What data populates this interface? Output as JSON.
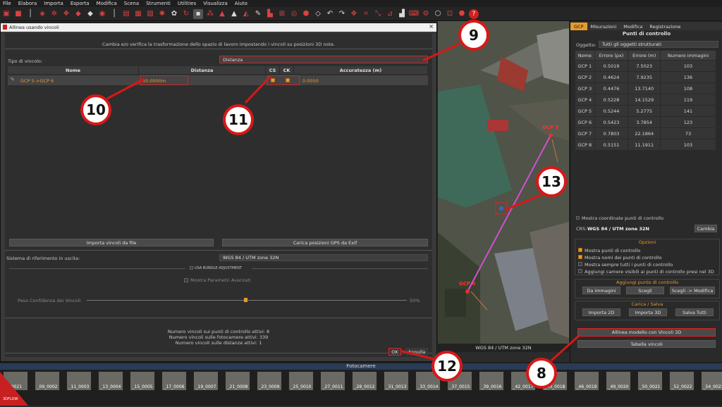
{
  "menu": [
    "File",
    "Elabora",
    "Importa",
    "Esporta",
    "Modifica",
    "Scena",
    "Strumenti",
    "Utilities",
    "Visualizza",
    "Aiuto"
  ],
  "dialog": {
    "title": "Allinea usando vincoli",
    "close": "×",
    "description": "Cambia e/o verifica la trasformazione dello spazio di lavoro impostando i vincoli su posizioni 3D note.",
    "constraint_type_label": "Tipo di vincolo:",
    "constraint_type_value": "Distanza",
    "table_headers": {
      "name": "Nome",
      "distance": "Distanza",
      "cs": "CS",
      "ck": "CK",
      "accuracy": "Accuratezza (m)"
    },
    "row": {
      "name": "GCP 5->GCP 6",
      "distance": "30.0000m",
      "accuracy": "0.0050"
    },
    "import_button": "Importa vincoli da file",
    "load_gps_button": "Carica posizioni GPS da Exif",
    "output_ref_label": "Sistema di riferimento in uscita:",
    "output_ref_value": "WGS 84 / UTM zone 32N",
    "bundle_label": "USA BUNDLE ADJUSTMENT",
    "advanced_label": "Mostra Parametri Avanzati",
    "weight_label": "Peso Confidenza dei Vincoli:",
    "weight_value": "50%",
    "stats": [
      "Numero vincoli sui punti di controllo attivi: 8",
      "Numero vincoli sulle fotocamere attivi: 339",
      "Numero vincoli sulle distanze attivi: 1"
    ],
    "ok": "OK",
    "cancel": "Annulla"
  },
  "callouts": {
    "c8": "8",
    "c9": "9",
    "c10": "10",
    "c11": "11",
    "c12": "12",
    "c13": "13"
  },
  "map": {
    "gcp5": "GCP 5",
    "gcp6": "GCP 6",
    "crs": "WGS 84 / UTM zone 32N"
  },
  "panel": {
    "tabs": [
      "GCP",
      "Misurazioni",
      "Modifica",
      "Registrazione"
    ],
    "title": "Punti di controllo",
    "object_label": "Oggetto:",
    "object_value": "Tutti gli oggetti strutturati",
    "headers": [
      "Nome",
      "Errore (px)",
      "Errore (m)",
      "Numero immagini"
    ],
    "rows": [
      [
        "GCP 1",
        "0.5019",
        "7.5023",
        "103"
      ],
      [
        "GCP 2",
        "0.4624",
        "7.9235",
        "136"
      ],
      [
        "GCP 3",
        "0.4476",
        "13.7140",
        "108"
      ],
      [
        "GCP 4",
        "0.5228",
        "14.1529",
        "119"
      ],
      [
        "GCP 5",
        "0.5244",
        "5.2775",
        "141"
      ],
      [
        "GCP 6",
        "0.5423",
        "3.7854",
        "123"
      ],
      [
        "GCP 7",
        "0.7803",
        "22.1864",
        "73"
      ],
      [
        "GCP 8",
        "0.5151",
        "11.1911",
        "103"
      ]
    ],
    "show_coords": "Mostra coordinate punti di controllo",
    "crs_label": "CRS:",
    "crs_value": "WGS 84 / UTM zone 32N",
    "change": "Cambia",
    "options_title": "Opzioni",
    "options": [
      "Mostra punti di controllo",
      "Mostra nomi dei punti di controllo",
      "Mostra sempre tutti i punti di controllo",
      "Aggiungi camere visibili ai punti di controllo presi nel 3D"
    ],
    "add_title": "Aggiungi punto di controllo",
    "add_buttons": [
      "Da immagini",
      "Scegli",
      "Scegli -> Modifica"
    ],
    "load_title": "Carica / Salva",
    "load_buttons": [
      "Importa 2D",
      "Importa 3D",
      "Salva Tutti"
    ],
    "align_button": "Allinea modello con Vincoli 3D",
    "constraints_table": "Tabella vincoli"
  },
  "filmstrip": {
    "title": "Fotocamere",
    "thumbs": [
      "_0021",
      "_09_0002",
      "_11_0003",
      "_13_0004",
      "_15_0005",
      "_17_0006",
      "_19_0007",
      "_21_0008",
      "_23_0009",
      "_25_0010",
      "_27_0011",
      "_28_0012",
      "_31_0013",
      "_33_0014",
      "_37_0015",
      "_39_0016",
      "_42_0017",
      "_43_0018",
      "_46_0019",
      "_49_0020",
      "_50_0021",
      "_52_0022",
      "_54_0023"
    ]
  },
  "logo_text": "3DFLOW"
}
